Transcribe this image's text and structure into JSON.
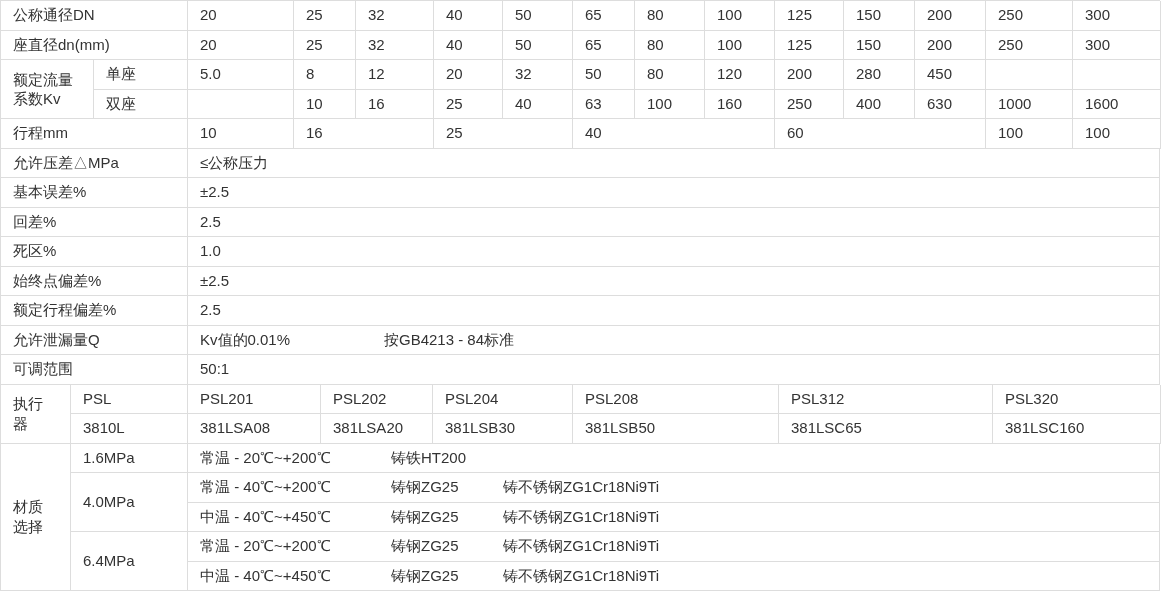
{
  "nominal_diameter": {
    "label": "公称通径DN",
    "values": [
      "20",
      "25",
      "32",
      "40",
      "50",
      "65",
      "80",
      "100",
      "125",
      "150",
      "200",
      "250",
      "300"
    ]
  },
  "seat_diameter": {
    "label": "座直径dn(mm)",
    "values": [
      "20",
      "25",
      "32",
      "40",
      "50",
      "65",
      "80",
      "100",
      "125",
      "150",
      "200",
      "250",
      "300"
    ]
  },
  "flow_coefficient": {
    "label": "额定流量系数Kv",
    "rows": [
      {
        "label": "单座",
        "values": [
          "5.0",
          "8",
          "12",
          "20",
          "32",
          "50",
          "80",
          "120",
          "200",
          "280",
          "450"
        ]
      },
      {
        "label": "双座",
        "values": [
          "10",
          "16",
          "25",
          "40",
          "63",
          "100",
          "160",
          "250",
          "400",
          "630",
          "1000",
          "1600"
        ]
      }
    ]
  },
  "stroke": {
    "label": "行程mm",
    "values": [
      "10",
      "16",
      "25",
      "40",
      "60",
      "100",
      "100"
    ]
  },
  "specs": [
    {
      "label": "允许压差△MPa",
      "values": [
        "≤公称压力"
      ]
    },
    {
      "label": "基本误差%",
      "values": [
        "±2.5"
      ]
    },
    {
      "label": "回差%",
      "values": [
        "2.5"
      ]
    },
    {
      "label": "死区%",
      "values": [
        "1.0"
      ]
    },
    {
      "label": "始终点偏差%",
      "values": [
        "±2.5"
      ]
    },
    {
      "label": "额定行程偏差%",
      "values": [
        "2.5"
      ]
    },
    {
      "label": "允许泄漏量Q",
      "values": [
        "Kv值的0.01%",
        "按GB4213 - 84标准"
      ]
    },
    {
      "label": "可调范围",
      "values": [
        "50:1"
      ]
    }
  ],
  "actuator": {
    "label": "执行器",
    "rows": [
      [
        "PSL",
        "PSL201",
        "PSL202",
        "PSL204",
        "PSL208",
        "PSL312",
        "PSL320"
      ],
      [
        "3810L",
        "381LSA08",
        "381LSA20",
        "381LSB30",
        "381LSB50",
        "381LSC65",
        "381LSC160"
      ]
    ]
  },
  "materials": {
    "label": "材质选择",
    "groups": [
      {
        "pressure": "1.6MPa",
        "rows": [
          [
            "常温 - 20℃~+200℃",
            "铸铁HT200"
          ]
        ]
      },
      {
        "pressure": "4.0MPa",
        "rows": [
          [
            "常温 - 40℃~+200℃",
            "铸钢ZG25",
            "铸不锈钢ZG1Cr18Ni9Ti"
          ],
          [
            "中温 - 40℃~+450℃",
            "铸钢ZG25",
            "铸不锈钢ZG1Cr18Ni9Ti"
          ]
        ]
      },
      {
        "pressure": "6.4MPa",
        "rows": [
          [
            "常温 - 20℃~+200℃",
            "铸钢ZG25",
            "铸不锈钢ZG1Cr18Ni9Ti"
          ],
          [
            "中温 - 40℃~+450℃",
            "铸钢ZG25",
            "铸不锈钢ZG1Cr18Ni9Ti"
          ]
        ]
      }
    ]
  }
}
